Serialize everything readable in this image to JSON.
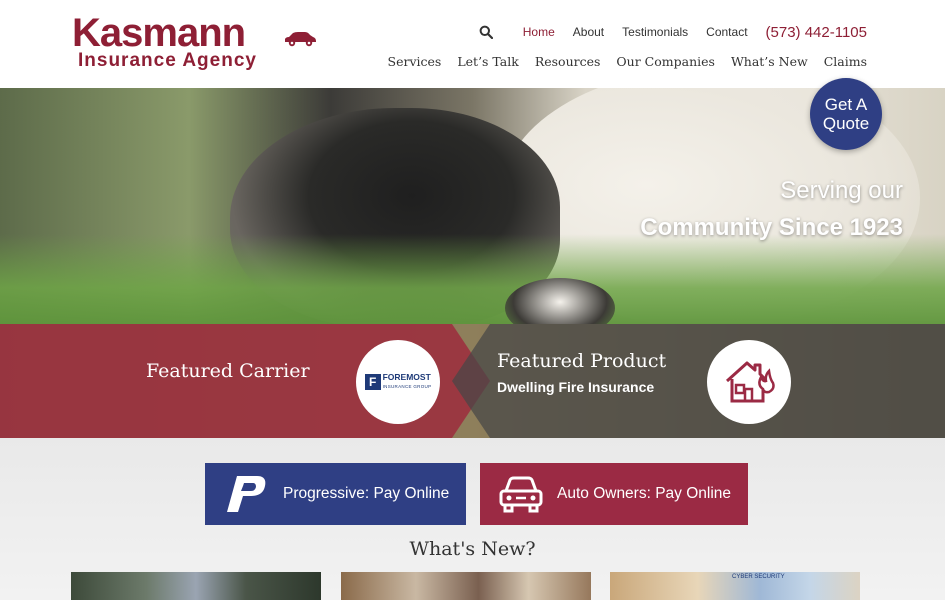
{
  "header": {
    "logo": {
      "name": "Kasmann",
      "tagline": "Insurance Agency"
    },
    "top_nav": [
      {
        "label": "Home",
        "active": true
      },
      {
        "label": "About",
        "active": false
      },
      {
        "label": "Testimonials",
        "active": false
      },
      {
        "label": "Contact",
        "active": false
      }
    ],
    "phone": "(573) 442-1105",
    "main_nav": [
      "Services",
      "Let’s Talk",
      "Resources",
      "Our Companies",
      "What’s New",
      "Claims"
    ],
    "search_icon": "search-icon"
  },
  "hero": {
    "line1": "Serving our",
    "line2": "Community Since 1923",
    "quote_button": {
      "line1": "Get A",
      "line2": "Quote"
    }
  },
  "featured": {
    "carrier_label": "Featured Carrier",
    "carrier_logo": {
      "mark": "F",
      "name": "FOREMOST",
      "sub": "INSURANCE GROUP"
    },
    "product_label": "Featured Product",
    "product_name": "Dwelling Fire Insurance",
    "product_icon": "house-fire-icon"
  },
  "payments": [
    {
      "label": "Progressive: Pay Online",
      "icon": "progressive-logo-icon"
    },
    {
      "label": "Auto Owners: Pay Online",
      "icon": "car-icon"
    }
  ],
  "whats_new": {
    "title": "What's New?",
    "thumb3_text": "CYBER SECURITY"
  },
  "colors": {
    "brand_red": "#8e1f35",
    "brand_blue": "#2f3f84",
    "auto_owners_red": "#9b2a44"
  }
}
